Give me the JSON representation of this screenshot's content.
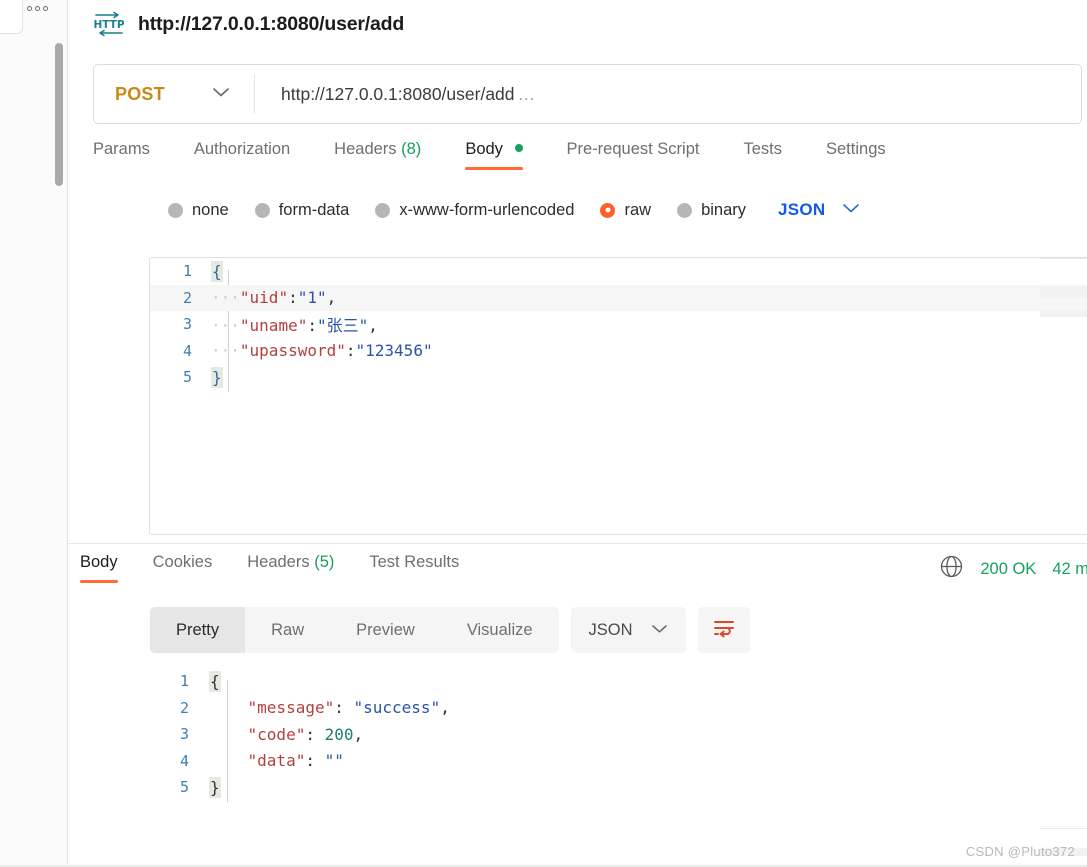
{
  "window": {
    "title": "http://127.0.0.1:8080/user/add",
    "type_icon": "http-icon"
  },
  "sidebar": {
    "more_icon": "three-dots-icon"
  },
  "request": {
    "method": "POST",
    "url": "http://127.0.0.1:8080/user/add",
    "url_overflow": "…",
    "tabs": [
      {
        "label": "Params",
        "active": false
      },
      {
        "label": "Authorization",
        "active": false
      },
      {
        "label": "Headers",
        "count": "(8)",
        "active": false
      },
      {
        "label": "Body",
        "active": true,
        "has_dot": true
      },
      {
        "label": "Pre-request Script",
        "active": false
      },
      {
        "label": "Tests",
        "active": false
      },
      {
        "label": "Settings",
        "active": false
      }
    ],
    "body_types": [
      {
        "label": "none",
        "selected": false
      },
      {
        "label": "form-data",
        "selected": false
      },
      {
        "label": "x-www-form-urlencoded",
        "selected": false
      },
      {
        "label": "raw",
        "selected": true
      },
      {
        "label": "binary",
        "selected": false
      }
    ],
    "body_format": "JSON",
    "body_lines": [
      {
        "no": "1",
        "brace": "{",
        "highlight": false
      },
      {
        "no": "2",
        "indent": "···",
        "key": "\"uid\"",
        "colon": ":",
        "value": "\"1\"",
        "comma": ",",
        "highlight": true
      },
      {
        "no": "3",
        "indent": "···",
        "key": "\"uname\"",
        "colon": ":",
        "value": "\"张三\"",
        "comma": ",",
        "highlight": false
      },
      {
        "no": "4",
        "indent": "···",
        "key": "\"upassword\"",
        "colon": ":",
        "value": "\"123456\"",
        "comma": "",
        "highlight": false
      },
      {
        "no": "5",
        "brace": "}",
        "highlight": false
      }
    ]
  },
  "response": {
    "tabs": [
      {
        "label": "Body",
        "active": true
      },
      {
        "label": "Cookies",
        "active": false
      },
      {
        "label": "Headers",
        "count": "(5)",
        "active": false
      },
      {
        "label": "Test Results",
        "active": false
      }
    ],
    "status_icon": "globe-icon",
    "status": "200 OK",
    "time": "42 m",
    "view_modes": [
      {
        "label": "Pretty",
        "active": true
      },
      {
        "label": "Raw",
        "active": false
      },
      {
        "label": "Preview",
        "active": false
      },
      {
        "label": "Visualize",
        "active": false
      }
    ],
    "format": "JSON",
    "wrap_icon": "wrap-lines-icon",
    "body_lines": [
      {
        "no": "1",
        "brace": "{"
      },
      {
        "no": "2",
        "indent": "    ",
        "key": "\"message\"",
        "colon": ": ",
        "value": "\"success\"",
        "type": "string",
        "comma": ","
      },
      {
        "no": "3",
        "indent": "    ",
        "key": "\"code\"",
        "colon": ": ",
        "value": "200",
        "type": "number",
        "comma": ","
      },
      {
        "no": "4",
        "indent": "    ",
        "key": "\"data\"",
        "colon": ": ",
        "value": "\"\"",
        "type": "string",
        "comma": ""
      },
      {
        "no": "5",
        "brace": "}"
      }
    ]
  },
  "watermark": "CSDN @Pluto372",
  "colors": {
    "accent": "#ff6c37",
    "method": "#c98a15",
    "success": "#17a05e",
    "json_blue": "#1159e8",
    "key": "#b34040",
    "string": "#2a54a8",
    "number": "#1e7f6d"
  }
}
